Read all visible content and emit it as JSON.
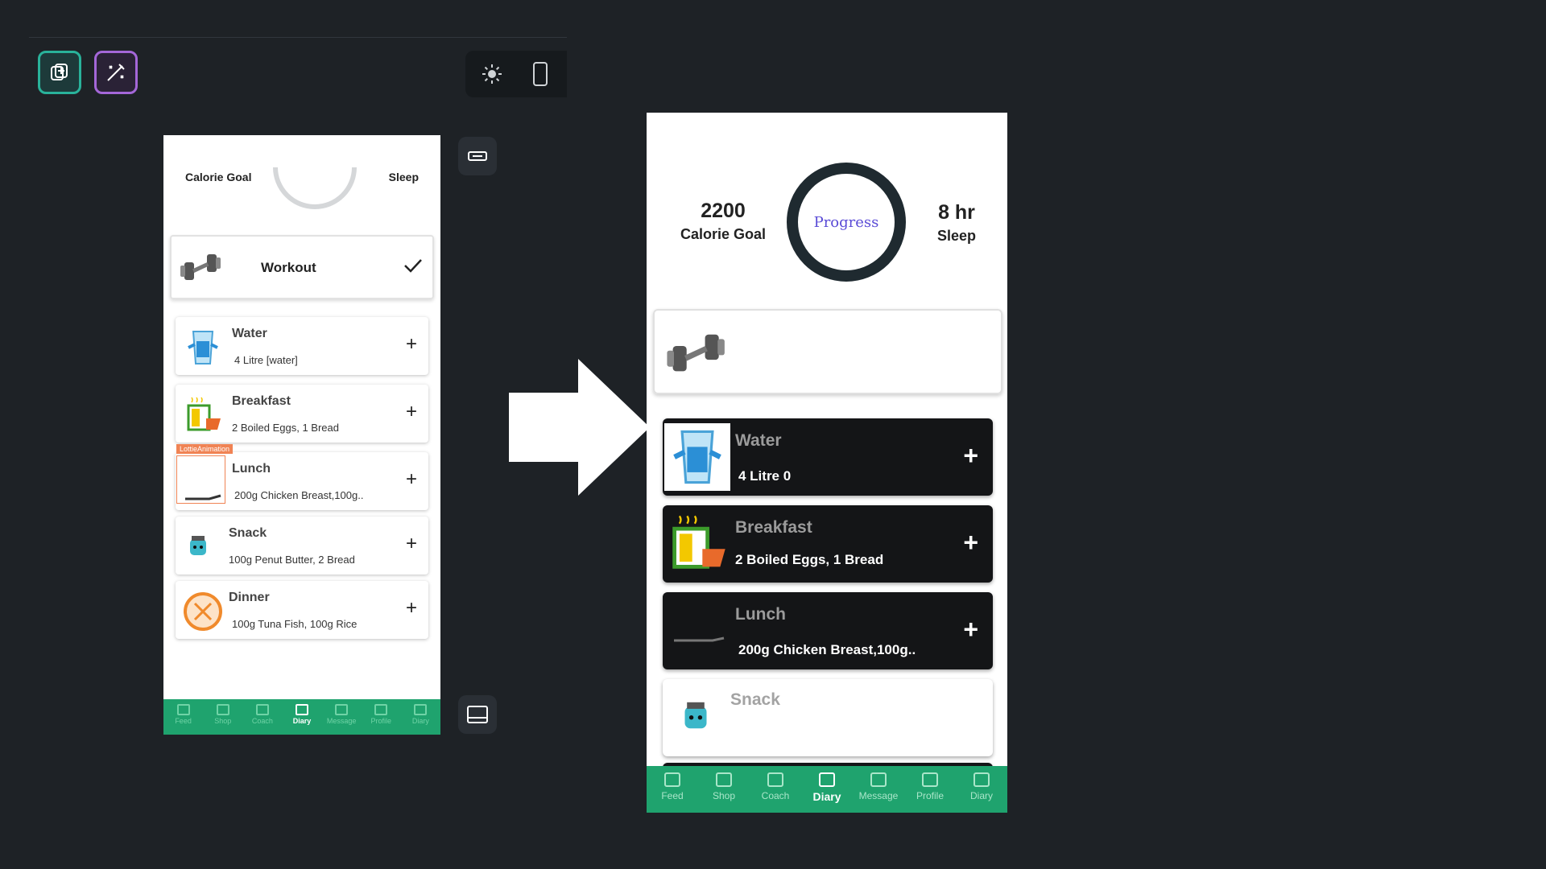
{
  "left": {
    "calorie_label": "Calorie Goal",
    "sleep_label": "Sleep",
    "workout_label": "Workout",
    "lottie_badge": "LottieAnimation",
    "meals": [
      {
        "title": "Water",
        "subtitle": "4 Litre [water]",
        "plus": "+"
      },
      {
        "title": "Breakfast",
        "subtitle": "2 Boiled Eggs, 1 Bread",
        "plus": "+"
      },
      {
        "title": "Lunch",
        "subtitle": "200g Chicken Breast,100g..",
        "plus": "+"
      },
      {
        "title": "Snack",
        "subtitle": "100g Penut Butter, 2 Bread",
        "plus": "+"
      },
      {
        "title": "Dinner",
        "subtitle": "100g Tuna Fish, 100g Rice",
        "plus": "+"
      }
    ],
    "nav": [
      "Feed",
      "Shop",
      "Coach",
      "Diary",
      "Message",
      "Profile",
      "Diary"
    ],
    "nav_active": "Diary"
  },
  "right": {
    "calorie_value": "2200",
    "calorie_label": "Calorie Goal",
    "progress_label": "Progress",
    "sleep_value": "8 hr",
    "sleep_label": "Sleep",
    "meals": [
      {
        "title": "Water",
        "subtitle": "4 Litre 0",
        "plus": "+"
      },
      {
        "title": "Breakfast",
        "subtitle": "2 Boiled Eggs, 1 Bread",
        "plus": "+"
      },
      {
        "title": "Lunch",
        "subtitle": "200g Chicken Breast,100g..",
        "plus": "+"
      },
      {
        "title": "Snack",
        "subtitle": "",
        "plus": ""
      }
    ],
    "nav": [
      "Feed",
      "Shop",
      "Coach",
      "Diary",
      "Message",
      "Profile",
      "Diary"
    ],
    "nav_active": "Diary"
  },
  "colors": {
    "background": "#1e2226",
    "nav_green": "#1fa36e",
    "progress_text": "#5a4bd6",
    "dark_card": "#141517"
  },
  "icons": {
    "tool_1": "add-widget-icon",
    "tool_2": "magic-edit-icon",
    "theme": "sun-icon",
    "device": "phone-icon"
  }
}
